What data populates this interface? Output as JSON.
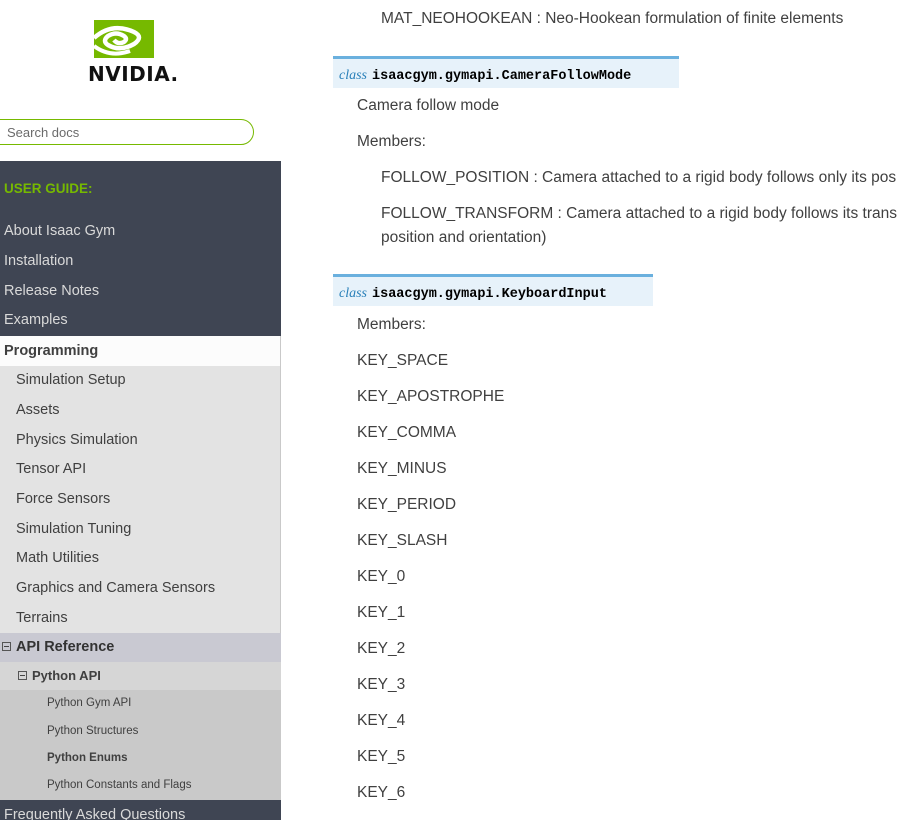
{
  "brand": {
    "logo_text": "NVIDIA.",
    "accent_color": "#76b900"
  },
  "search": {
    "placeholder": "Search docs"
  },
  "sidebar": {
    "caption": "USER GUIDE:",
    "top_items": [
      "About Isaac Gym",
      "Installation",
      "Release Notes",
      "Examples"
    ],
    "current": "Programming",
    "programming_items": [
      "Simulation Setup",
      "Assets",
      "Physics Simulation",
      "Tensor API",
      "Force Sensors",
      "Simulation Tuning",
      "Math Utilities",
      "Graphics and Camera Sensors",
      "Terrains"
    ],
    "api_reference": "API Reference",
    "python_api": "Python API",
    "python_api_items": [
      "Python Gym API",
      "Python Structures",
      "Python Enums",
      "Python Constants and Flags"
    ],
    "current_leaf": "Python Enums",
    "faq": "Frequently Asked Questions"
  },
  "content": {
    "mat_neohookean": "MAT_NEOHOOKEAN : Neo-Hookean formulation of finite elements",
    "camera_follow": {
      "class_keyword": "class",
      "signature": "isaacgym.gymapi.CameraFollowMode",
      "description": "Camera follow mode",
      "members_label": "Members:",
      "follow_position": "FOLLOW_POSITION : Camera attached to a rigid body follows only its pos",
      "follow_transform_line1": "FOLLOW_TRANSFORM : Camera attached to a rigid body follows its trans",
      "follow_transform_line2": "position and orientation)"
    },
    "keyboard_input": {
      "class_keyword": "class",
      "signature": "isaacgym.gymapi.KeyboardInput",
      "members_label": "Members:",
      "keys": [
        "KEY_SPACE",
        "KEY_APOSTROPHE",
        "KEY_COMMA",
        "KEY_MINUS",
        "KEY_PERIOD",
        "KEY_SLASH",
        "KEY_0",
        "KEY_1",
        "KEY_2",
        "KEY_3",
        "KEY_4",
        "KEY_5",
        "KEY_6"
      ]
    }
  }
}
